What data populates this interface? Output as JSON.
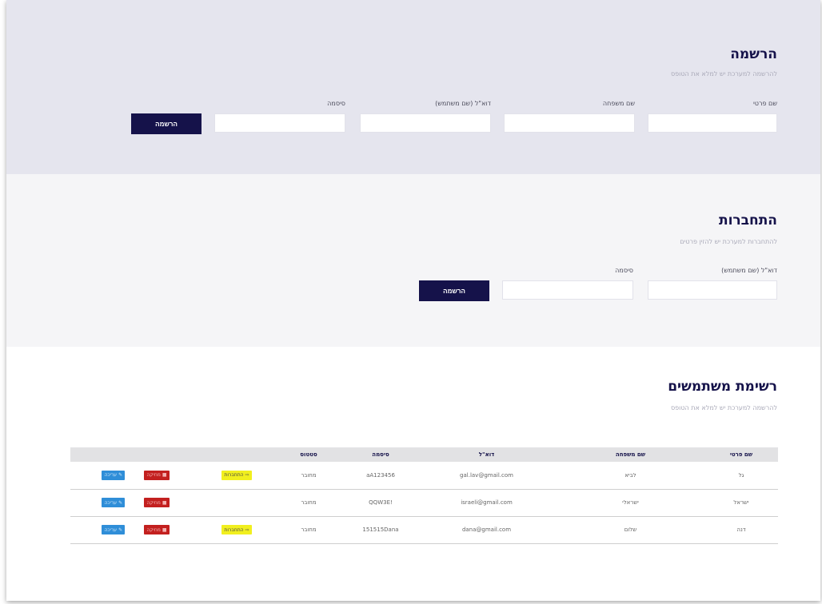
{
  "register": {
    "title": "הרשמה",
    "subtitle": "להרשמה למערכת יש למלא את הטופס",
    "fields": [
      {
        "label": "שם פרטי"
      },
      {
        "label": "שם משפחה"
      },
      {
        "label": "דוא\"ל (שם משתמש)"
      },
      {
        "label": "סיסמה"
      }
    ],
    "button": "הרשמה"
  },
  "login": {
    "title": "התחברות",
    "subtitle": "להתחברות למערכת יש להזין פרטים",
    "fields": [
      {
        "label": "דוא\"ל (שם משתמש)"
      },
      {
        "label": "סיסמה"
      }
    ],
    "button": "הרשמה"
  },
  "users": {
    "title": "רשימת משתמשים",
    "subtitle": "להרשמה למערכת יש למלא את הטופס",
    "columns": [
      "שם פרטי",
      "שם משפחה",
      "דוא\"ל",
      "סיסמה",
      "סטטוס"
    ],
    "rows": [
      {
        "first": "גל",
        "last": "לביא",
        "email": "gal.lav@gmail.com",
        "password": "aA123456",
        "status": "מחובר",
        "connect": "התחברות"
      },
      {
        "first": "ישראל",
        "last": "ישראלי",
        "email": "israeli@gmail.com",
        "password": "!QQW3E",
        "status": "מחובר",
        "connect": ""
      },
      {
        "first": "דנה",
        "last": "שלום",
        "email": "dana@gmail.com",
        "password": "151515Dana",
        "status": "מחובר",
        "connect": "התחברות"
      }
    ],
    "actions": {
      "edit": "עריכה",
      "delete": "מחיקה"
    }
  },
  "colors": {
    "primary": "#15124a",
    "register_bg": "#e5e5ee",
    "login_bg": "#f5f5f7",
    "edit": "#2f8ed8",
    "delete": "#c3201f",
    "connect": "#f1ef1f"
  },
  "icons": {
    "edit": "edit-icon",
    "delete": "trash-icon",
    "connect": "login-icon"
  }
}
